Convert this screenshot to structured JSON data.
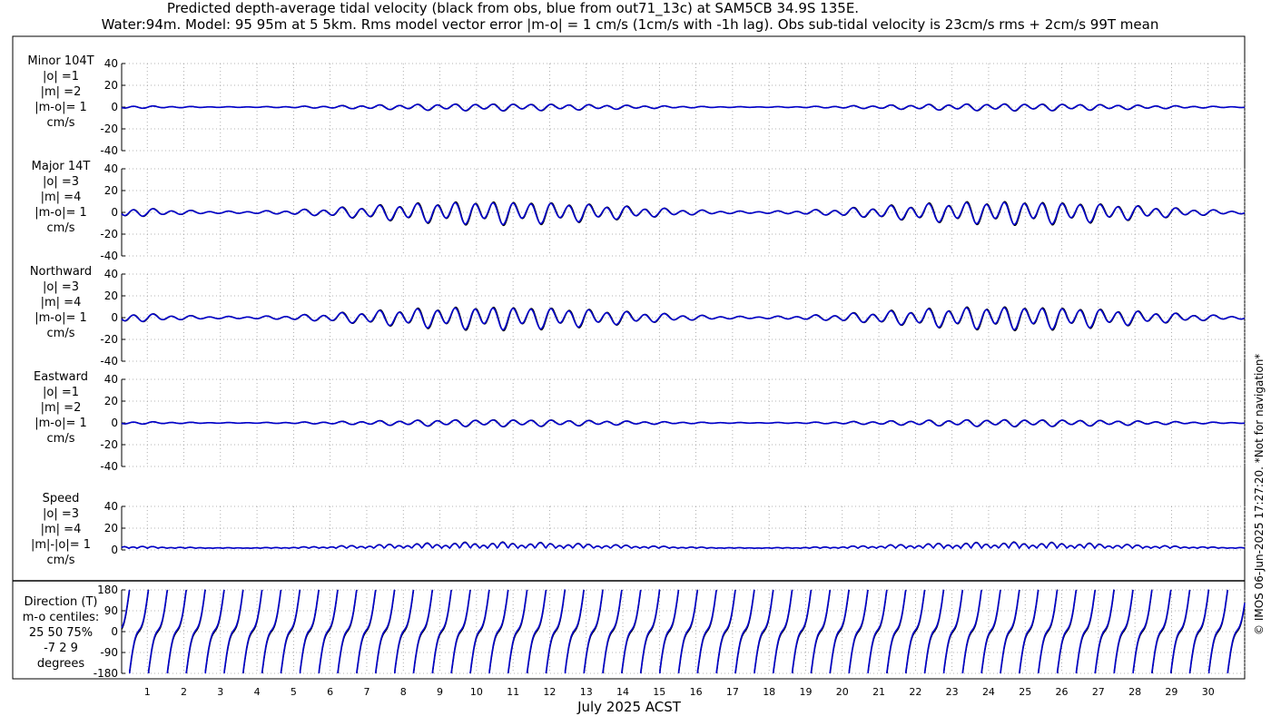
{
  "title_line1": "Predicted depth-average tidal velocity (black from obs, blue from out71_13c) at SAM5CB 34.9S 135E.",
  "title_line2": "Water:94m. Model: 95 95m at 5 5km. Rms model vector error |m-o| = 1 cm/s (1cm/s with -1h lag). Obs sub-tidal velocity is 23cm/s rms + 2cm/s 99T mean",
  "side_note": "© IMOS 06-Jun-2025 17:27:20. *Not for navigation*",
  "colors": {
    "obs": "#000000",
    "model": "#0000cc",
    "grid": "#9a9a9a"
  },
  "chart_data": {
    "type": "line",
    "xlabel": "July 2025 ACST",
    "x_ticks": [
      "1",
      "2",
      "3",
      "4",
      "5",
      "6",
      "7",
      "8",
      "9",
      "10",
      "11",
      "12",
      "13",
      "14",
      "15",
      "16",
      "17",
      "18",
      "19",
      "20",
      "21",
      "22",
      "23",
      "24",
      "25",
      "26",
      "27",
      "28",
      "29",
      "30"
    ],
    "x_range_days": [
      0.3,
      31.0
    ],
    "grid": true,
    "series_legend": {
      "obs": "black from obs",
      "model": "blue from out71_13c"
    },
    "panels": [
      {
        "key": "minor",
        "label": [
          "Minor 104T",
          "|o| =1",
          "|m| =2",
          "|m-o|= 1",
          "cm/s"
        ],
        "ylim": [
          -40,
          40
        ],
        "yticks": [
          "40",
          "20",
          "0",
          "-20",
          "-40"
        ],
        "amplitude_cm_s": 3
      },
      {
        "key": "major",
        "label": [
          "Major 14T",
          "|o| =3",
          "|m| =4",
          "|m-o|= 1",
          "cm/s"
        ],
        "ylim": [
          -40,
          40
        ],
        "yticks": [
          "40",
          "20",
          "0",
          "-20",
          "-40"
        ],
        "amplitude_cm_s": 9
      },
      {
        "key": "north",
        "label": [
          "Northward",
          "|o| =3",
          "|m| =4",
          "|m-o|= 1",
          "cm/s"
        ],
        "ylim": [
          -40,
          40
        ],
        "yticks": [
          "40",
          "20",
          "0",
          "-20",
          "-40"
        ],
        "amplitude_cm_s": 9
      },
      {
        "key": "east",
        "label": [
          "Eastward",
          "|o| =1",
          "|m| =2",
          "|m-o|= 1",
          "cm/s"
        ],
        "ylim": [
          -40,
          40
        ],
        "yticks": [
          "40",
          "20",
          "0",
          "-20",
          "-40"
        ],
        "amplitude_cm_s": 3
      },
      {
        "key": "speed",
        "label": [
          "Speed",
          "|o| =3",
          "|m| =4",
          "|m|-|o|= 1",
          "cm/s"
        ],
        "ylim": [
          0,
          40
        ],
        "yticks": [
          "40",
          "20",
          "0"
        ],
        "amplitude_cm_s": 8
      },
      {
        "key": "direction",
        "label": [
          "Direction (T)",
          "m-o centiles:",
          "25  50  75%",
          "-7  2  9",
          "degrees"
        ],
        "ylim": [
          -180,
          180
        ],
        "yticks": [
          "180",
          "90",
          "0",
          "-90",
          "-180"
        ]
      }
    ]
  }
}
